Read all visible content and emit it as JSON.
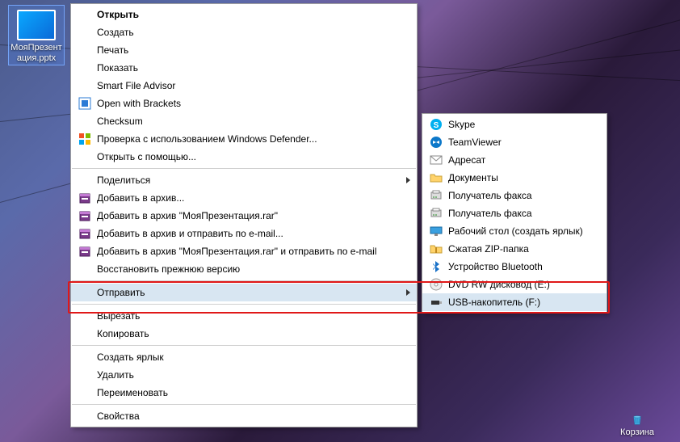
{
  "desktop": {
    "file_name": "МояПрезентация.pptx",
    "recycle_label": "Корзина"
  },
  "menu1": {
    "groups": [
      [
        {
          "id": "open",
          "label": "Открыть",
          "bold": true
        },
        {
          "id": "create",
          "label": "Создать"
        },
        {
          "id": "print",
          "label": "Печать"
        },
        {
          "id": "show",
          "label": "Показать"
        },
        {
          "id": "sfa",
          "label": "Smart File Advisor"
        },
        {
          "id": "brackets",
          "label": "Open with Brackets",
          "icon": "brackets"
        },
        {
          "id": "checksum",
          "label": "Checksum"
        },
        {
          "id": "defender",
          "label": "Проверка с использованием Windows Defender...",
          "icon": "defender"
        },
        {
          "id": "openwith",
          "label": "Открыть с помощью..."
        }
      ],
      [
        {
          "id": "share",
          "label": "Поделиться",
          "submenu": true
        },
        {
          "id": "rar-add",
          "label": "Добавить в архив...",
          "icon": "rar"
        },
        {
          "id": "rar-named",
          "label": "Добавить в архив \"МояПрезентация.rar\"",
          "icon": "rar"
        },
        {
          "id": "rar-mail",
          "label": "Добавить в архив и отправить по e-mail...",
          "icon": "rar"
        },
        {
          "id": "rar-named-mail",
          "label": "Добавить в архив \"МояПрезентация.rar\" и отправить по e-mail",
          "icon": "rar"
        },
        {
          "id": "restore",
          "label": "Восстановить прежнюю версию"
        }
      ],
      [
        {
          "id": "sendto",
          "label": "Отправить",
          "submenu": true,
          "highlight": true
        }
      ],
      [
        {
          "id": "cut",
          "label": "Вырезать"
        },
        {
          "id": "copy",
          "label": "Копировать"
        }
      ],
      [
        {
          "id": "shortcut",
          "label": "Создать ярлык"
        },
        {
          "id": "delete",
          "label": "Удалить"
        },
        {
          "id": "rename",
          "label": "Переименовать"
        }
      ],
      [
        {
          "id": "props",
          "label": "Свойства"
        }
      ]
    ]
  },
  "menu2": {
    "items": [
      {
        "id": "skype",
        "label": "Skype",
        "icon": "skype"
      },
      {
        "id": "teamviewer",
        "label": "TeamViewer",
        "icon": "tv"
      },
      {
        "id": "addr",
        "label": "Адресат",
        "icon": "mail"
      },
      {
        "id": "docs",
        "label": "Документы",
        "icon": "folder"
      },
      {
        "id": "fax1",
        "label": "Получатель факса",
        "icon": "fax"
      },
      {
        "id": "fax2",
        "label": "Получатель факса",
        "icon": "fax"
      },
      {
        "id": "deskshort",
        "label": "Рабочий стол (создать ярлык)",
        "icon": "desk"
      },
      {
        "id": "zip",
        "label": "Сжатая ZIP-папка",
        "icon": "zip"
      },
      {
        "id": "bt",
        "label": "Устройство Bluetooth",
        "icon": "bt"
      },
      {
        "id": "dvd",
        "label": "DVD RW дисковод (E:)",
        "icon": "disc"
      },
      {
        "id": "usb",
        "label": "USB-накопитель (F:)",
        "icon": "usb",
        "highlight": true
      }
    ]
  }
}
